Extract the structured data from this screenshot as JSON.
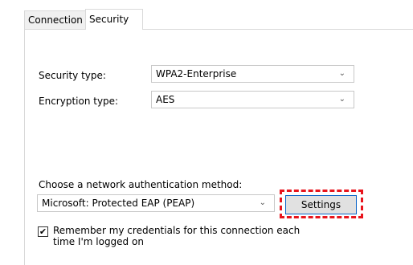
{
  "tabs": {
    "connection": "Connection",
    "security": "Security"
  },
  "security_type": {
    "label": "Security type:",
    "value": "WPA2-Enterprise"
  },
  "encryption_type": {
    "label": "Encryption type:",
    "value": "AES"
  },
  "auth_method": {
    "label": "Choose a network authentication method:",
    "value": "Microsoft: Protected EAP (PEAP)",
    "settings_button": "Settings"
  },
  "remember": {
    "checked": true,
    "line1": "Remember my credentials for this connection each",
    "line2": "time I'm logged on"
  },
  "icons": {
    "dropdown": "chevron-down-icon",
    "check": "checkmark-icon"
  },
  "colors": {
    "highlight": "#e8141c",
    "focus_border": "#0a64c8"
  }
}
